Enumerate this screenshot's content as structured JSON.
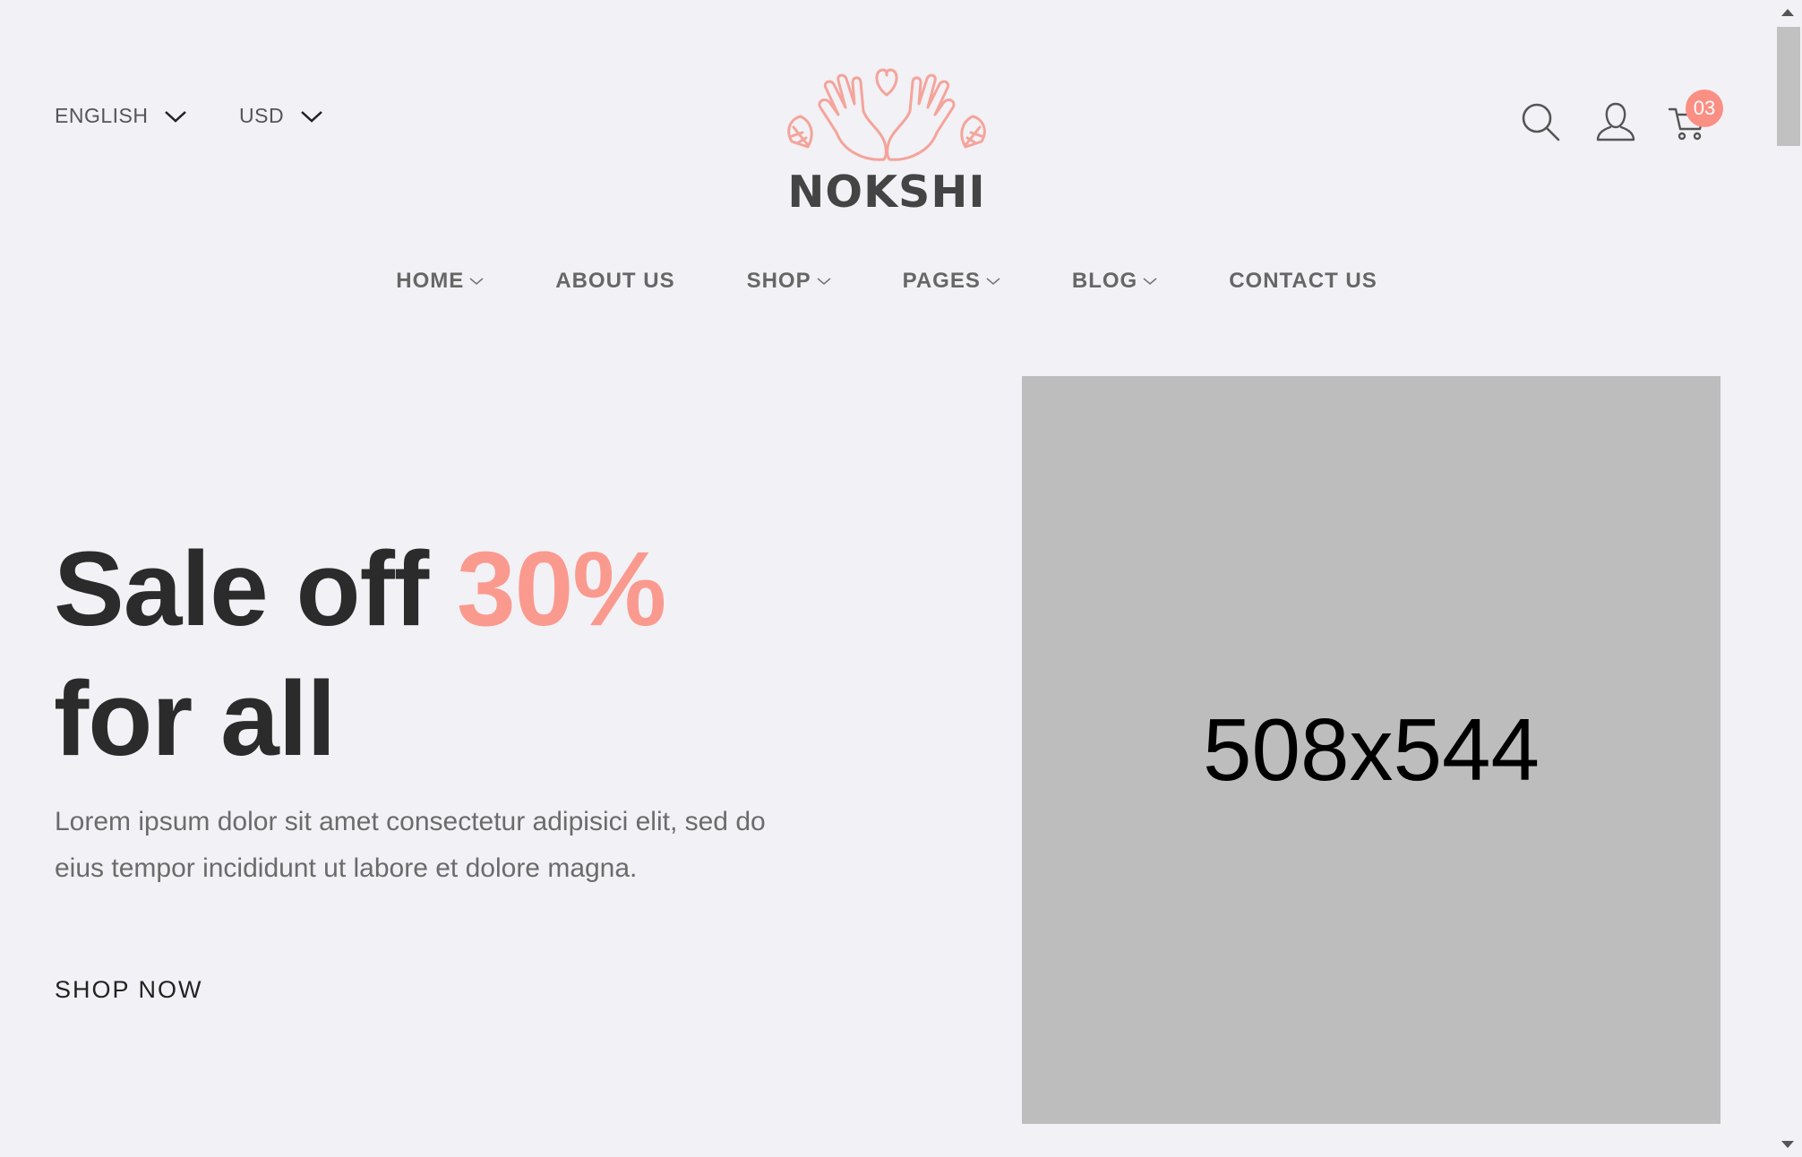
{
  "header": {
    "language": {
      "label": "ENGLISH",
      "icon": "chevron-down-icon"
    },
    "currency": {
      "label": "USD",
      "icon": "chevron-down-icon"
    },
    "logo": {
      "text": "NOKSHI",
      "icon": "hands-heart-logo-icon"
    },
    "actions": {
      "search_icon": "search-icon",
      "account_icon": "user-icon",
      "cart_icon": "cart-icon",
      "cart_count": "03"
    }
  },
  "nav": {
    "items": [
      {
        "label": "HOME",
        "has_dropdown": true
      },
      {
        "label": "ABOUT US",
        "has_dropdown": false
      },
      {
        "label": "SHOP",
        "has_dropdown": true
      },
      {
        "label": "PAGES",
        "has_dropdown": true
      },
      {
        "label": "BLOG",
        "has_dropdown": true
      },
      {
        "label": "CONTACT US",
        "has_dropdown": false
      }
    ]
  },
  "hero": {
    "title_prefix": "Sale off ",
    "title_accent": "30%",
    "title_suffix": "for all",
    "description": "Lorem ipsum dolor sit amet consectetur adipisici elit, sed do eius tempor incididunt ut labore et dolore magna.",
    "cta_label": "SHOP NOW",
    "image_placeholder": "508x544"
  },
  "colors": {
    "background": "#f2f1f5",
    "accent": "#fa9a8f",
    "badge": "#fa8f84",
    "image_placeholder": "#bdbdbd"
  }
}
